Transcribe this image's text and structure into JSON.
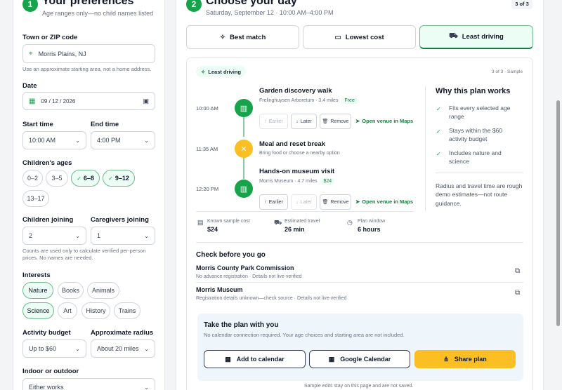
{
  "left": {
    "step": "1",
    "title": "Your preferences",
    "subtitle": "Age ranges only—no child names listed",
    "location": {
      "label": "Town or ZIP code",
      "value": "Morris Plains, NJ",
      "help": "Use an approximate starting area, not a home address."
    },
    "date": {
      "label": "Date",
      "value": "09 / 12 / 2026"
    },
    "start_time": {
      "label": "Start time",
      "value": "10:00 AM"
    },
    "end_time": {
      "label": "End time",
      "value": "4:00 PM"
    },
    "ages": {
      "label": "Children's ages",
      "options": [
        {
          "label": "0–2",
          "selected": false
        },
        {
          "label": "3–5",
          "selected": false
        },
        {
          "label": "6–8",
          "selected": true
        },
        {
          "label": "9–12",
          "selected": true
        },
        {
          "label": "13–17",
          "selected": false
        }
      ]
    },
    "children_joining": {
      "label": "Children joining",
      "value": "2"
    },
    "caregivers_joining": {
      "label": "Caregivers joining",
      "value": "1"
    },
    "counts_help": "Counts are used only to calculate verified per-person prices. No names are needed.",
    "interests": {
      "label": "Interests",
      "options": [
        {
          "label": "Nature",
          "selected": true
        },
        {
          "label": "Books",
          "selected": false
        },
        {
          "label": "Animals",
          "selected": false
        },
        {
          "label": "Science",
          "selected": true
        },
        {
          "label": "Art",
          "selected": false
        },
        {
          "label": "History",
          "selected": false
        },
        {
          "label": "Trains",
          "selected": false
        }
      ]
    },
    "budget": {
      "label": "Activity budget",
      "value": "Up to $60"
    },
    "radius": {
      "label": "Approximate radius",
      "value": "About 20 miles"
    },
    "indoor_outdoor": {
      "label": "Indoor or outdoor",
      "value": "Either works"
    }
  },
  "right": {
    "step": "2",
    "title": "Choose your day",
    "subtitle": "Saturday, September 12 · 10:00 AM–4:00 PM",
    "page_badge": "3 of 3",
    "tabs": [
      {
        "label": "Best match",
        "icon": "sparkle-icon",
        "selected": false
      },
      {
        "label": "Lowest cost",
        "icon": "wallet-icon",
        "selected": false
      },
      {
        "label": "Least driving",
        "icon": "car-icon",
        "selected": true
      }
    ],
    "plan": {
      "badge": "Least driving",
      "meta": "3 of 3 · Sample",
      "stops": [
        {
          "time": "10:00 AM",
          "title": "Garden discovery walk",
          "sub": "Frelinghuysen Arboretum · 3.4 miles",
          "tag": "Free",
          "icon": "book-icon",
          "actions": {
            "earlier": "Earlier",
            "later": "Later",
            "remove": "Remove",
            "map": "Open venue in Maps"
          }
        },
        {
          "time": "11:35 AM",
          "title": "Meal and reset break",
          "sub": "Bring food or choose a nearby option",
          "icon": "utensils-icon"
        },
        {
          "time": "12:20 PM",
          "title": "Hands-on museum visit",
          "sub": "Morris Museum · 4.7 miles",
          "tag": "$24",
          "icon": "book-icon",
          "actions": {
            "earlier": "Earlier",
            "later": "Later",
            "remove": "Remove",
            "map": "Open venue in Maps"
          }
        }
      ],
      "why": {
        "title": "Why this plan works",
        "items": [
          "Fits every selected age range",
          "Stays within the $60 activity budget",
          "Includes nature and science"
        ],
        "note": "Radius and travel time are rough demo estimates—not route guidance."
      },
      "stats": [
        {
          "label": "Known sample cost",
          "value": "$24",
          "icon": "receipt-icon"
        },
        {
          "label": "Estimated travel",
          "value": "26 min",
          "icon": "car-icon"
        },
        {
          "label": "Plan window",
          "value": "6 hours",
          "icon": "clock-icon"
        }
      ],
      "check": {
        "title": "Check before you go",
        "venues": [
          {
            "name": "Morris County Park Commission",
            "sub": "No advance registration · Details not live-verified"
          },
          {
            "name": "Morris Museum",
            "sub": "Registration details unknown—check source · Details not live-verified"
          }
        ]
      },
      "take": {
        "title": "Take the plan with you",
        "sub": "No calendar connection required. Your age choices and starting area are not included.",
        "buttons": {
          "calendar": "Add to calendar",
          "google": "Google Calendar",
          "share": "Share plan"
        }
      },
      "footer": "Sample edits stay on this page and are not saved."
    }
  },
  "colors": {
    "accent": "#16a34a",
    "accent_light": "#ecfdf5",
    "cta": "#fbbf24"
  }
}
